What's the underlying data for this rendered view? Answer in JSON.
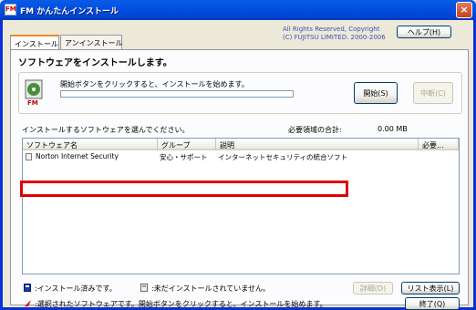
{
  "window": {
    "title": "FM かんたんインストール",
    "icon_label": "FM",
    "close_label": "×"
  },
  "tabs": [
    {
      "label": "インストール",
      "active": true
    },
    {
      "label": "アンインストール",
      "active": false
    }
  ],
  "header": {
    "copyright_line1": "All Rights Reserved, Copyright",
    "copyright_line2": "(C) FUJITSU LIMITED. 2000-2006",
    "help_label": "ヘルプ(H)"
  },
  "panel": {
    "title": "ソフトウェアをインストールします。",
    "progress_label": "開始ボタンをクリックすると、インストールを始めます。",
    "progress_value": 0,
    "start_label": "開始(S)",
    "stop_label": "中断(C)"
  },
  "list": {
    "caption": "インストールするソフトウェアを選んでください。",
    "space_label": "必要領域の合計:",
    "space_value": "0.00 MB",
    "columns": [
      "ソフトウェア名",
      "グループ",
      "説明",
      "必要..."
    ],
    "rows": [
      {
        "name": "Norton Internet Security",
        "group": "安心・サポート",
        "desc": "インターネットセキュリティの統合ソフト",
        "size": ""
      }
    ]
  },
  "legend": {
    "installed": ":インストール済みです。",
    "not_installed": ":未だインストールされていません。",
    "selected": ":選択されたソフトウェアです。開始ボタンをクリックすると、インストールを始めます。"
  },
  "buttons": {
    "detail": "詳細(D)",
    "list_view": "リスト表示(L)",
    "exit": "終了(Q)"
  },
  "colors": {
    "titlebar": "#0054e3",
    "highlight": "#e00000",
    "selected_mark": "#e00000"
  }
}
